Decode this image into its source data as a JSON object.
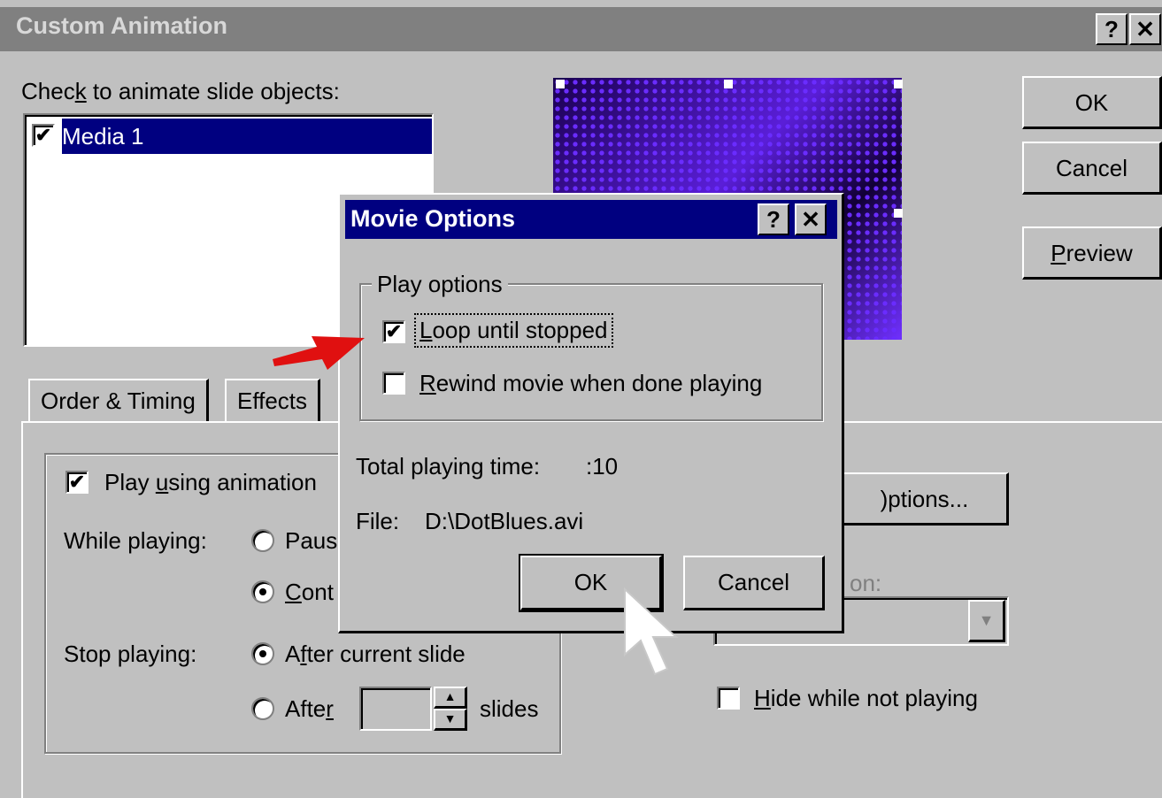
{
  "main_dialog": {
    "title": "Custom Animation",
    "help_btn": "?",
    "close_btn": "✕",
    "objects_label_pre": "Chec",
    "objects_label_key": "k",
    "objects_label_post": " to animate slide objects:",
    "objects": [
      {
        "label": "Media 1",
        "checked": true
      }
    ],
    "buttons": {
      "ok": "OK",
      "cancel": "Cancel",
      "preview_key": "P",
      "preview_rest": "review"
    },
    "tabs": [
      {
        "label": "Order & Timing"
      },
      {
        "label": "Effects"
      }
    ],
    "play_using_pre": "Play ",
    "play_using_key": "u",
    "play_using_post": "sing animation",
    "while_playing_label": "While playing:",
    "while_opt1": "Paus",
    "while_opt2_key": "C",
    "while_opt2_rest": "ont",
    "stop_playing_label": "Stop playing:",
    "stop_opt1_pre": "A",
    "stop_opt1_key": "f",
    "stop_opt1_post": "ter current slide",
    "stop_opt2_pre": "Afte",
    "stop_opt2_key": "r",
    "slides_label": "slides",
    "more_options_btn": ")ptions...",
    "dropdown_label": "on:",
    "hide_pre": "",
    "hide_key": "H",
    "hide_post": "ide while not playing"
  },
  "movie_dialog": {
    "title": "Movie Options",
    "help_btn": "?",
    "close_btn": "✕",
    "group_label": "Play options",
    "loop_key": "L",
    "loop_rest": "oop until stopped",
    "loop_checked": true,
    "rewind_key": "R",
    "rewind_rest": "ewind movie when done playing",
    "rewind_checked": false,
    "total_time_label": "Total playing time:",
    "total_time_value": ":10",
    "file_label": "File:",
    "file_value": "D:\\DotBlues.avi",
    "ok": "OK",
    "cancel": "Cancel"
  },
  "colors": {
    "selection": "#000080",
    "title_active": "#000080",
    "title_inactive": "#808080",
    "arrow": "#e01010"
  }
}
